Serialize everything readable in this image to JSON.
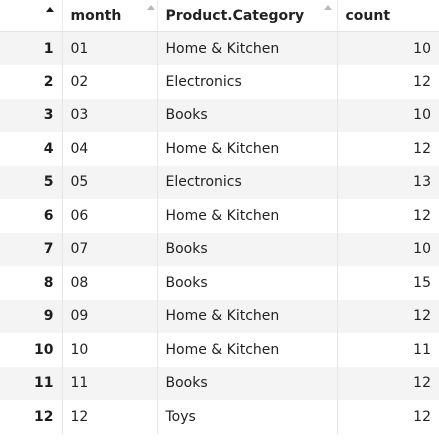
{
  "table": {
    "headers": {
      "index": "",
      "month": "month",
      "category": "Product.Category",
      "count": "count"
    },
    "rows": [
      {
        "idx": "1",
        "month": "01",
        "category": "Home & Kitchen",
        "count": "10"
      },
      {
        "idx": "2",
        "month": "02",
        "category": "Electronics",
        "count": "12"
      },
      {
        "idx": "3",
        "month": "03",
        "category": "Books",
        "count": "10"
      },
      {
        "idx": "4",
        "month": "04",
        "category": "Home & Kitchen",
        "count": "12"
      },
      {
        "idx": "5",
        "month": "05",
        "category": "Electronics",
        "count": "13"
      },
      {
        "idx": "6",
        "month": "06",
        "category": "Home & Kitchen",
        "count": "12"
      },
      {
        "idx": "7",
        "month": "07",
        "category": "Books",
        "count": "10"
      },
      {
        "idx": "8",
        "month": "08",
        "category": "Books",
        "count": "15"
      },
      {
        "idx": "9",
        "month": "09",
        "category": "Home & Kitchen",
        "count": "12"
      },
      {
        "idx": "10",
        "month": "10",
        "category": "Home & Kitchen",
        "count": "11"
      },
      {
        "idx": "11",
        "month": "11",
        "category": "Books",
        "count": "12"
      },
      {
        "idx": "12",
        "month": "12",
        "category": "Toys",
        "count": "12"
      }
    ]
  },
  "icons": {
    "sort": "sort-triangle-icon"
  }
}
